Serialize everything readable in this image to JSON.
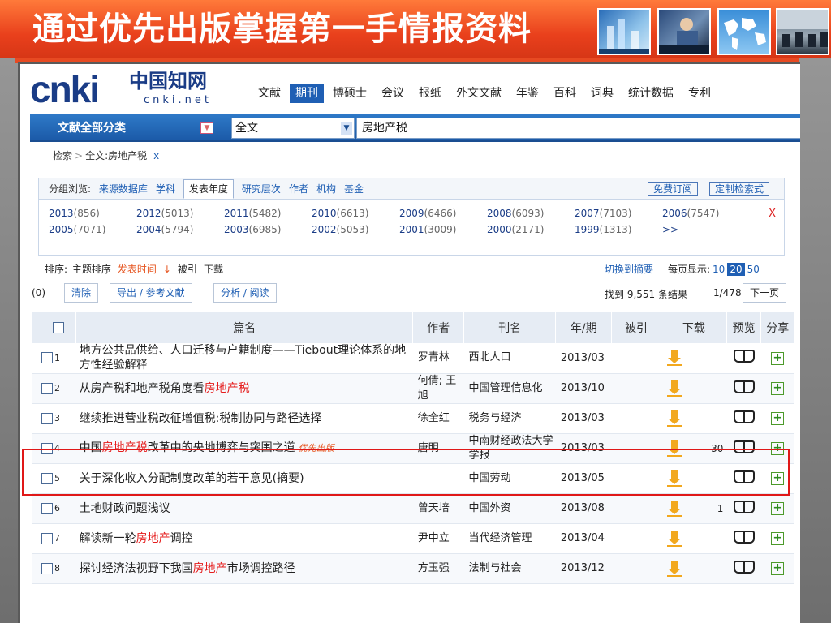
{
  "slide": {
    "title": "通过优先出版掌握第一手情报资料",
    "images": [
      "lab-photo",
      "office-photo",
      "world-map-photo",
      "meeting-photo"
    ]
  },
  "logo": {
    "brand": "cnki",
    "cn": "中国知网",
    "url": "cnki.net"
  },
  "nav": [
    "文献",
    "期刊",
    "博硕士",
    "会议",
    "报纸",
    "外文文献",
    "年鉴",
    "百科",
    "词典",
    "统计数据",
    "专利"
  ],
  "nav_active": "期刊",
  "search": {
    "category": "文献全部分类",
    "field": "全文",
    "query": "房地产税"
  },
  "breadcrumb": {
    "root": "检索",
    "current": "全文:房地产税",
    "close": "x"
  },
  "group": {
    "label": "分组浏览:",
    "tabs": [
      "来源数据库",
      "学科",
      "发表年度",
      "研究层次",
      "作者",
      "机构",
      "基金"
    ],
    "selected": "发表年度",
    "free_subscribe": "免费订阅",
    "custom": "定制检索式",
    "close": "X",
    "years_row1": [
      {
        "y": "2013",
        "c": "(856)"
      },
      {
        "y": "2012",
        "c": "(5013)"
      },
      {
        "y": "2011",
        "c": "(5482)"
      },
      {
        "y": "2010",
        "c": "(6613)"
      },
      {
        "y": "2009",
        "c": "(6466)"
      },
      {
        "y": "2008",
        "c": "(6093)"
      },
      {
        "y": "2007",
        "c": "(7103)"
      },
      {
        "y": "2006",
        "c": "(7547)"
      }
    ],
    "years_row2": [
      {
        "y": "2005",
        "c": "(7071)"
      },
      {
        "y": "2004",
        "c": "(5794)"
      },
      {
        "y": "2003",
        "c": "(6985)"
      },
      {
        "y": "2002",
        "c": "(5053)"
      },
      {
        "y": "2001",
        "c": "(3009)"
      },
      {
        "y": "2000",
        "c": "(2171)"
      },
      {
        "y": "1999",
        "c": "(1313)"
      },
      {
        "y": ">>",
        "c": ""
      }
    ]
  },
  "sort": {
    "label": "排序:",
    "options": [
      "主题排序",
      "发表时间",
      "被引",
      "下载"
    ],
    "active": "发表时间",
    "switch": "切换到摘要",
    "per_page_label": "每页显示:",
    "per_page": [
      "10",
      "20",
      "50"
    ],
    "per_page_selected": "20"
  },
  "toolbar": {
    "selected_count": "(0)",
    "clear": "清除",
    "export": "导出 / 参考文献",
    "analyze": "分析 / 阅读",
    "found": "找到 9,551 条结果",
    "page": "1/478",
    "next": "下一页"
  },
  "table": {
    "headers": [
      "篇名",
      "作者",
      "刊名",
      "年/期",
      "被引",
      "下载",
      "预览",
      "分享"
    ],
    "rows": [
      {
        "n": "1",
        "title": [
          {
            "t": "地方公共品供给、人口迁移与户籍制度——Tiebout理论体系的地方性经验解释",
            "h": false
          }
        ],
        "tag": "",
        "author": "罗青林",
        "journal": "西北人口",
        "jc": "normal",
        "year": "2013/03",
        "cite": "",
        "dl": ""
      },
      {
        "n": "2",
        "title": [
          {
            "t": "从房产税和地产税角度看",
            "h": false
          },
          {
            "t": "房地产税",
            "h": true
          }
        ],
        "tag": "",
        "author": "何倩; 王旭",
        "journal": "中国管理信息化",
        "jc": "normal",
        "year": "2013/10",
        "cite": "",
        "dl": ""
      },
      {
        "n": "3",
        "title": [
          {
            "t": "继续推进营业税改征增值税:税制协同与路径选择",
            "h": false
          }
        ],
        "tag": "",
        "author": "徐全红",
        "journal": "税务与经济",
        "jc": "pink",
        "year": "2013/03",
        "cite": "",
        "dl": ""
      },
      {
        "n": "4",
        "title": [
          {
            "t": "中国",
            "h": false
          },
          {
            "t": "房地产税",
            "h": true
          },
          {
            "t": "改革中的央地博弈与突围之道",
            "h": false
          }
        ],
        "tag": "优先出版",
        "author": "唐明",
        "journal": "中南财经政法大学学报",
        "jc": "pink",
        "year": "2013/03",
        "cite": "",
        "dl": "30"
      },
      {
        "n": "5",
        "title": [
          {
            "t": "关于深化收入分配制度改革的若干意见(摘要)",
            "h": false
          }
        ],
        "tag": "",
        "author": "",
        "journal": "中国劳动",
        "jc": "pink",
        "year": "2013/05",
        "cite": "",
        "dl": ""
      },
      {
        "n": "6",
        "title": [
          {
            "t": "土地财政问题浅议",
            "h": false
          }
        ],
        "tag": "",
        "author": "曾天培",
        "journal": "中国外资",
        "jc": "normal",
        "year": "2013/08",
        "cite": "",
        "dl": "1"
      },
      {
        "n": "7",
        "title": [
          {
            "t": "解读新一轮",
            "h": false
          },
          {
            "t": "房地产",
            "h": true
          },
          {
            "t": "调控",
            "h": false
          }
        ],
        "tag": "",
        "author": "尹中立",
        "journal": "当代经济管理",
        "jc": "normal",
        "year": "2013/04",
        "cite": "",
        "dl": ""
      },
      {
        "n": "8",
        "title": [
          {
            "t": "探讨经济法视野下我国",
            "h": false
          },
          {
            "t": "房地产",
            "h": true
          },
          {
            "t": "市场调控路径",
            "h": false
          }
        ],
        "tag": "",
        "author": "方玉强",
        "journal": "法制与社会",
        "jc": "normal",
        "year": "2013/12",
        "cite": "",
        "dl": ""
      }
    ]
  },
  "colors": {
    "banner": "#e9401c",
    "accent": "#1f5fb4",
    "highlight": "#e51d1d",
    "journal_pink": "#d3189b",
    "download": "#f2a81e"
  }
}
